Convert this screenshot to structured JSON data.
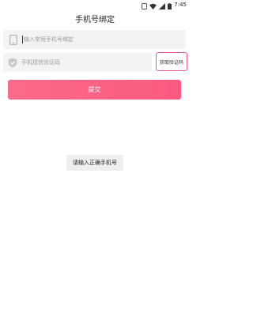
{
  "status_bar": {
    "time": "7:45",
    "icons": [
      "wifi-icon",
      "cellular-signal-icon",
      "battery-icon",
      "notification-icon"
    ]
  },
  "header": {
    "title": "手机号绑定"
  },
  "form": {
    "phone": {
      "placeholder": "输入常用手机号绑定",
      "value": "",
      "icon": "phone-icon"
    },
    "code": {
      "placeholder": "手机短信验证码",
      "value": "",
      "icon": "shield-check-icon"
    },
    "get_code_label": "获取验证码",
    "submit_label": "提交"
  },
  "toast": {
    "message": "请输入正确手机号"
  },
  "colors": {
    "accent": "#fb5e84",
    "field_bg": "#f3f3f3",
    "toast_bg": "#eeeeee"
  }
}
